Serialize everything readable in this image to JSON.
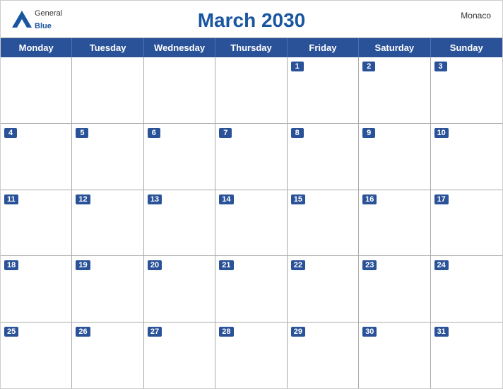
{
  "header": {
    "title": "March 2030",
    "country": "Monaco",
    "logo": {
      "general": "General",
      "blue": "Blue"
    }
  },
  "dayHeaders": [
    "Monday",
    "Tuesday",
    "Wednesday",
    "Thursday",
    "Friday",
    "Saturday",
    "Sunday"
  ],
  "weeks": [
    [
      {
        "date": "",
        "empty": true
      },
      {
        "date": "",
        "empty": true
      },
      {
        "date": "",
        "empty": true
      },
      {
        "date": "",
        "empty": true
      },
      {
        "date": "1"
      },
      {
        "date": "2"
      },
      {
        "date": "3"
      }
    ],
    [
      {
        "date": "4"
      },
      {
        "date": "5"
      },
      {
        "date": "6"
      },
      {
        "date": "7"
      },
      {
        "date": "8"
      },
      {
        "date": "9"
      },
      {
        "date": "10"
      }
    ],
    [
      {
        "date": "11"
      },
      {
        "date": "12"
      },
      {
        "date": "13"
      },
      {
        "date": "14"
      },
      {
        "date": "15"
      },
      {
        "date": "16"
      },
      {
        "date": "17"
      }
    ],
    [
      {
        "date": "18"
      },
      {
        "date": "19"
      },
      {
        "date": "20"
      },
      {
        "date": "21"
      },
      {
        "date": "22"
      },
      {
        "date": "23"
      },
      {
        "date": "24"
      }
    ],
    [
      {
        "date": "25"
      },
      {
        "date": "26"
      },
      {
        "date": "27"
      },
      {
        "date": "28"
      },
      {
        "date": "29"
      },
      {
        "date": "30"
      },
      {
        "date": "31"
      }
    ]
  ]
}
